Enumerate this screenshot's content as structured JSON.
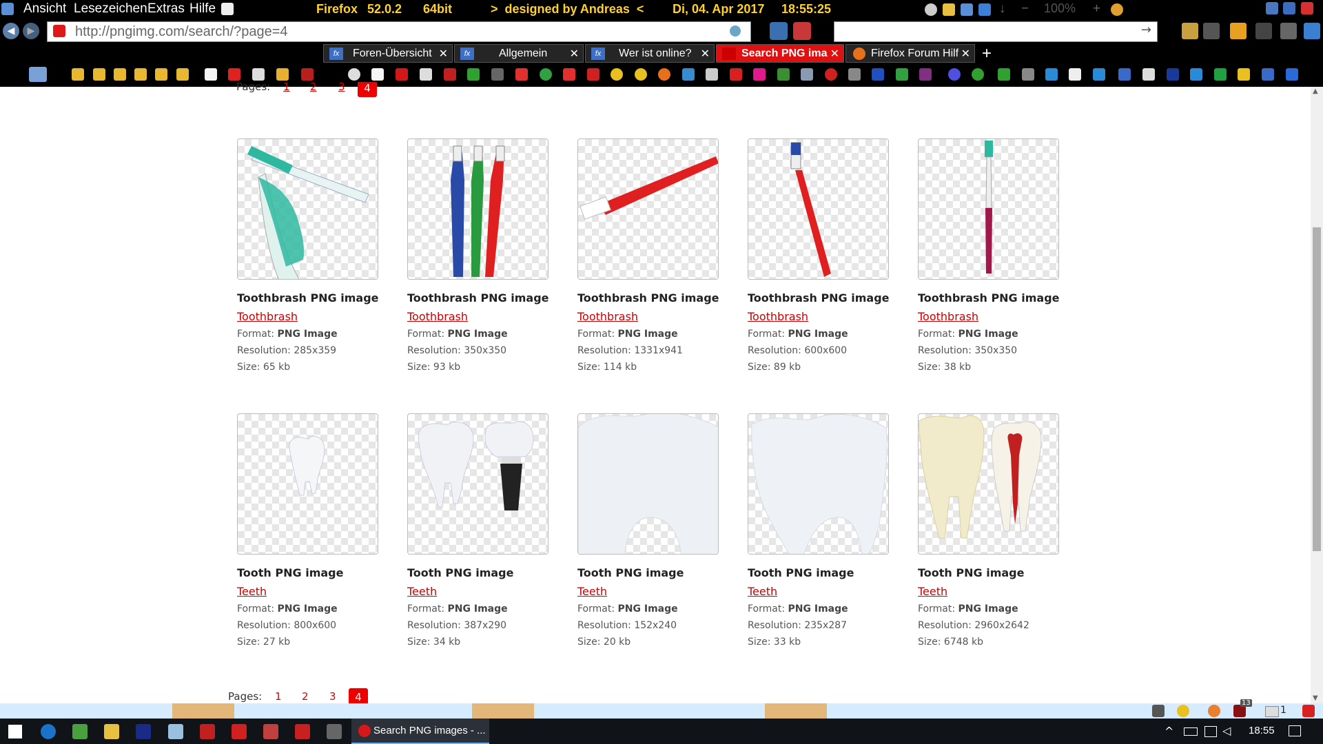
{
  "menubar": {
    "menus": [
      "Ansicht",
      "Lesezeichen",
      "Extras",
      "Hilfe"
    ],
    "browser": "Firefox",
    "version": "52.0.2",
    "arch": "64bit",
    "credit": ">  designed by Andreas  <",
    "date": "Di, 04. Apr 2017",
    "time": "18:55:25",
    "zoom": "100%"
  },
  "navbar": {
    "url": "http://pngimg.com/search/?page=4"
  },
  "tabs": [
    {
      "label": "Foren-Übersicht",
      "icon": "fx-icon"
    },
    {
      "label": "Allgemein",
      "icon": "fx-icon"
    },
    {
      "label": "Wer ist online?",
      "icon": "fx-icon"
    },
    {
      "label": "Search PNG ima",
      "icon": "pngimg-icon"
    },
    {
      "label": "Firefox Forum Hilf",
      "icon": "firefox-icon"
    }
  ],
  "page": {
    "pages_label": "Pages:",
    "pages": [
      "1",
      "2",
      "3",
      "4"
    ],
    "current_page": "4"
  },
  "cards_row1": [
    {
      "title": "Toothbrash PNG image",
      "category": "Toothbrash",
      "format_label": "Format:",
      "format": "PNG Image",
      "resolution_label": "Resolution:",
      "resolution": "285x359",
      "size_label": "Size:",
      "size": "65 kb"
    },
    {
      "title": "Toothbrash PNG image",
      "category": "Toothbrash",
      "format_label": "Format:",
      "format": "PNG Image",
      "resolution_label": "Resolution:",
      "resolution": "350x350",
      "size_label": "Size:",
      "size": "93 kb"
    },
    {
      "title": "Toothbrash PNG image",
      "category": "Toothbrash",
      "format_label": "Format:",
      "format": "PNG Image",
      "resolution_label": "Resolution:",
      "resolution": "1331x941",
      "size_label": "Size:",
      "size": "114 kb"
    },
    {
      "title": "Toothbrash PNG image",
      "category": "Toothbrash",
      "format_label": "Format:",
      "format": "PNG Image",
      "resolution_label": "Resolution:",
      "resolution": "600x600",
      "size_label": "Size:",
      "size": "89 kb"
    },
    {
      "title": "Toothbrash PNG image",
      "category": "Toothbrash",
      "format_label": "Format:",
      "format": "PNG Image",
      "resolution_label": "Resolution:",
      "resolution": "350x350",
      "size_label": "Size:",
      "size": "38 kb"
    }
  ],
  "cards_row2": [
    {
      "title": "Tooth PNG image",
      "category": "Teeth",
      "format_label": "Format:",
      "format": "PNG Image",
      "resolution_label": "Resolution:",
      "resolution": "800x600",
      "size_label": "Size:",
      "size": "27 kb"
    },
    {
      "title": "Tooth PNG image",
      "category": "Teeth",
      "format_label": "Format:",
      "format": "PNG Image",
      "resolution_label": "Resolution:",
      "resolution": "387x290",
      "size_label": "Size:",
      "size": "34 kb"
    },
    {
      "title": "Tooth PNG image",
      "category": "Teeth",
      "format_label": "Format:",
      "format": "PNG Image",
      "resolution_label": "Resolution:",
      "resolution": "152x240",
      "size_label": "Size:",
      "size": "20 kb"
    },
    {
      "title": "Tooth PNG image",
      "category": "Teeth",
      "format_label": "Format:",
      "format": "PNG Image",
      "resolution_label": "Resolution:",
      "resolution": "235x287",
      "size_label": "Size:",
      "size": "33 kb"
    },
    {
      "title": "Tooth PNG image",
      "category": "Teeth",
      "format_label": "Format:",
      "format": "PNG Image",
      "resolution_label": "Resolution:",
      "resolution": "2960x2642",
      "size_label": "Size:",
      "size": "6748 kb"
    }
  ],
  "taskbar": {
    "active_window": "Search PNG images - ...",
    "clock": "18:55",
    "badge_count": "13",
    "mail_count": "1"
  },
  "colors": {
    "accent_red": "#e00000",
    "menubar_gold": "#ffd22a",
    "brush_teal": "#2fb8a0",
    "brush_red": "#e02020"
  }
}
